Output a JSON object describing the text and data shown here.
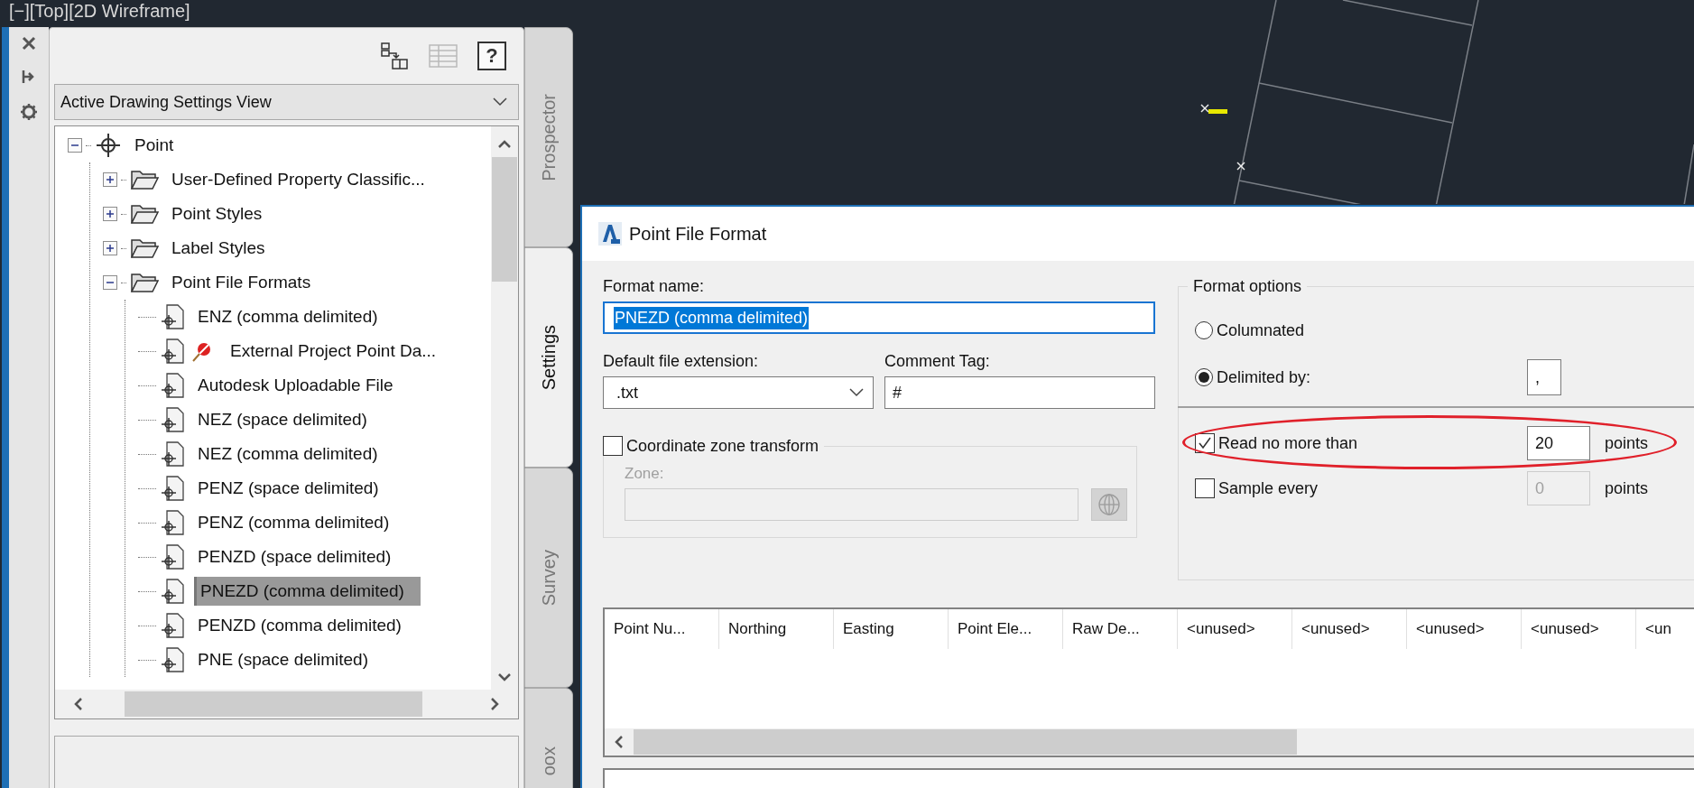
{
  "viewport": {
    "label": "[−][Top][2D Wireframe]"
  },
  "palette": {
    "toolbar": [
      {
        "kind": "hierarchy",
        "disabled": false
      },
      {
        "kind": "list",
        "disabled": true
      },
      {
        "kind": "help",
        "label": "?",
        "disabled": false
      }
    ],
    "view_selector": "Active Drawing Settings View",
    "tree": [
      {
        "kind": "point",
        "label": "Point",
        "expanded": true,
        "children": [
          {
            "kind": "folder",
            "label": "User-Defined Property Classific...",
            "expanded": false
          },
          {
            "kind": "folder",
            "label": "Point Styles",
            "expanded": false
          },
          {
            "kind": "folder",
            "label": "Label Styles",
            "expanded": false
          },
          {
            "kind": "folder",
            "label": "Point File Formats",
            "expanded": true,
            "children": [
              {
                "kind": "format",
                "label": "ENZ (comma delimited)",
                "selected": false
              },
              {
                "kind": "linked_format",
                "label": "External Project Point Da...",
                "selected": false
              },
              {
                "kind": "format",
                "label": "Autodesk Uploadable File",
                "selected": false
              },
              {
                "kind": "format",
                "label": "NEZ (space delimited)",
                "selected": false
              },
              {
                "kind": "format",
                "label": "NEZ (comma delimited)",
                "selected": false
              },
              {
                "kind": "format",
                "label": "PENZ (space delimited)",
                "selected": false
              },
              {
                "kind": "format",
                "label": "PENZ (comma delimited)",
                "selected": false
              },
              {
                "kind": "format",
                "label": "PENZD (space delimited)",
                "selected": false
              },
              {
                "kind": "format",
                "label": "PNEZD (comma delimited)",
                "selected": true
              },
              {
                "kind": "format",
                "label": "PENZD (comma delimited)",
                "selected": false
              },
              {
                "kind": "format",
                "label": "PNE (space delimited)",
                "selected": false
              }
            ]
          }
        ]
      }
    ],
    "side_tabs": [
      {
        "label": "Prospector",
        "selected": false
      },
      {
        "label": "Settings",
        "selected": true
      },
      {
        "label": "Survey",
        "selected": false
      },
      {
        "label": "oox",
        "selected": false
      }
    ]
  },
  "dialog": {
    "title": "Point File Format",
    "format_name": {
      "label": "Format name:",
      "value": "PNEZD (comma delimited)"
    },
    "file_extension": {
      "label": "Default file extension:",
      "value": ".txt"
    },
    "comment_tag": {
      "label": "Comment Tag:",
      "value": "#"
    },
    "zone_transform": {
      "label": "Coordinate zone transform",
      "checked": false,
      "zone_label": "Zone:"
    },
    "format_options": {
      "title": "Format options",
      "delimiter": ",",
      "modes": [
        {
          "label": "Columnated",
          "selected": false
        },
        {
          "label": "Delimited by:",
          "selected": true
        }
      ],
      "limits": [
        {
          "label": "Read no more than",
          "checked": true,
          "value": "20",
          "unit": "points",
          "highlighted": true
        },
        {
          "label": "Sample every",
          "checked": false,
          "value": "0",
          "unit": "points"
        }
      ]
    },
    "columns": [
      "Point Nu...",
      "Northing",
      "Easting",
      "Point Ele...",
      "Raw De...",
      "<unused>",
      "<unused>",
      "<unused>",
      "<unused>",
      "<un"
    ]
  }
}
